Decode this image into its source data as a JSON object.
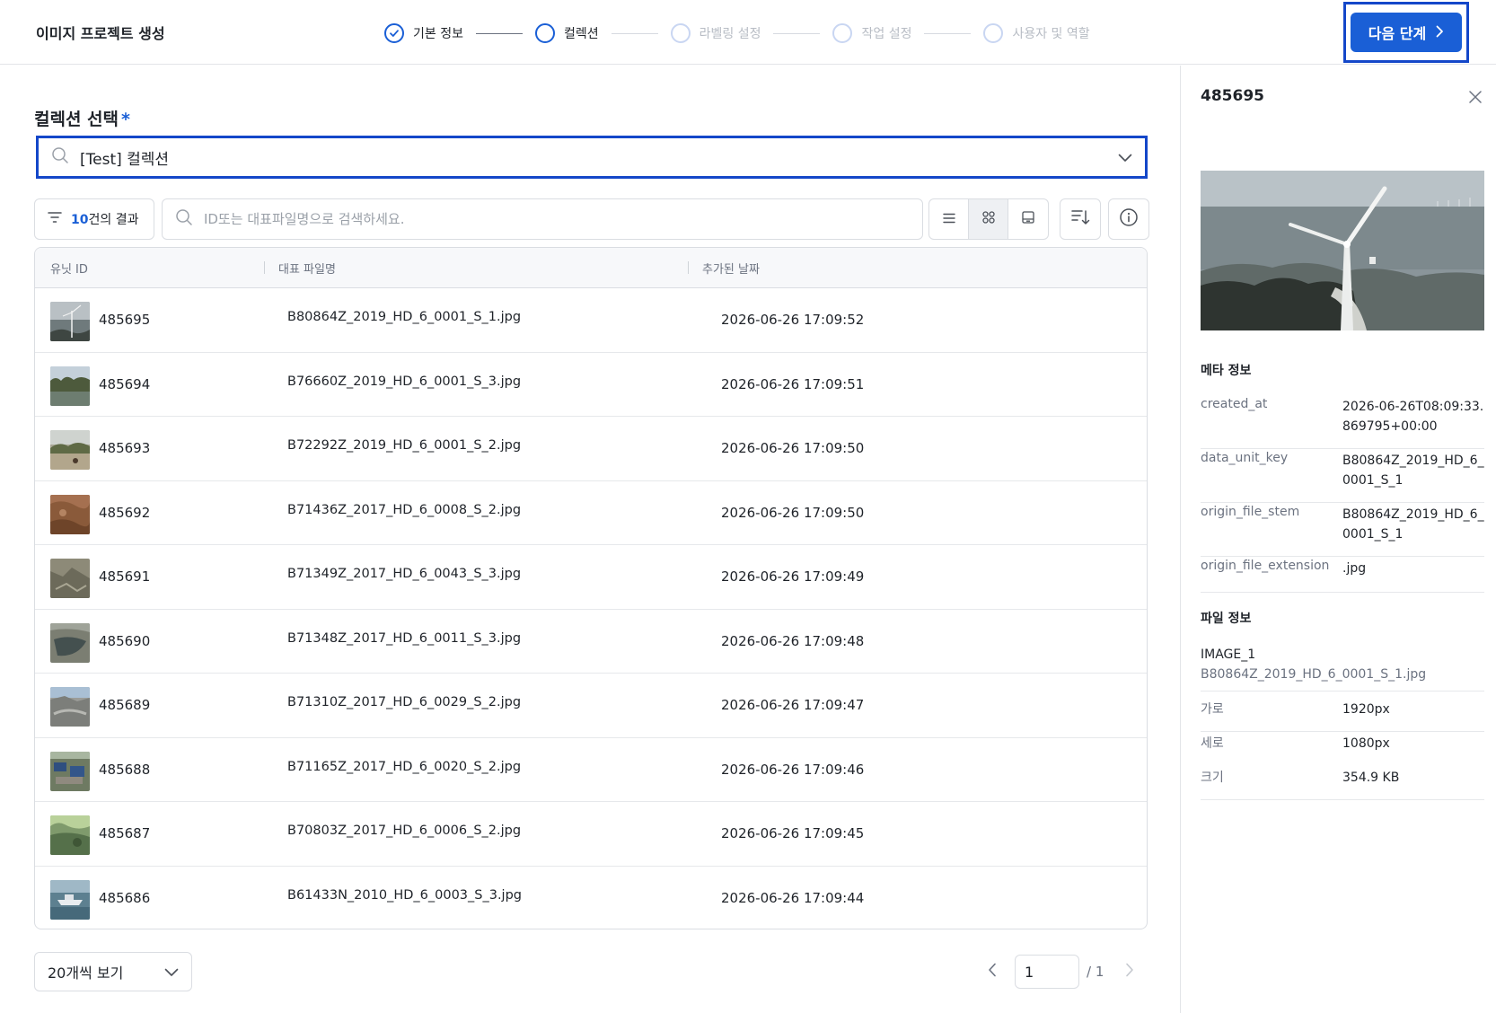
{
  "header": {
    "title": "이미지 프로젝트 생성",
    "steps": [
      {
        "label": "기본 정보",
        "state": "done"
      },
      {
        "label": "컬렉션",
        "state": "current"
      },
      {
        "label": "라벨링 설정",
        "state": "pending"
      },
      {
        "label": "작업 설정",
        "state": "pending"
      },
      {
        "label": "사용자 및 역할",
        "state": "pending"
      }
    ],
    "next_button": "다음 단계"
  },
  "collection": {
    "label": "컬렉션 선택",
    "required_mark": "*",
    "selected": "[Test] 컬렉션"
  },
  "toolbar": {
    "result_count": "10",
    "result_suffix": "건의 결과",
    "search_placeholder": "ID또는 대표파일명으로 검색하세요.",
    "view_modes": [
      "list",
      "grid",
      "gallery"
    ],
    "selected_view": "grid"
  },
  "table": {
    "columns": [
      "유닛 ID",
      "대표 파일명",
      "추가된 날짜"
    ],
    "rows": [
      {
        "id": "485695",
        "file": "B80864Z_2019_HD_6_0001_S_1.jpg",
        "date": "2026-06-26 17:09:52"
      },
      {
        "id": "485694",
        "file": "B76660Z_2019_HD_6_0001_S_3.jpg",
        "date": "2026-06-26 17:09:51"
      },
      {
        "id": "485693",
        "file": "B72292Z_2019_HD_6_0001_S_2.jpg",
        "date": "2026-06-26 17:09:50"
      },
      {
        "id": "485692",
        "file": "B71436Z_2017_HD_6_0008_S_2.jpg",
        "date": "2026-06-26 17:09:50"
      },
      {
        "id": "485691",
        "file": "B71349Z_2017_HD_6_0043_S_3.jpg",
        "date": "2026-06-26 17:09:49"
      },
      {
        "id": "485690",
        "file": "B71348Z_2017_HD_6_0011_S_3.jpg",
        "date": "2026-06-26 17:09:48"
      },
      {
        "id": "485689",
        "file": "B71310Z_2017_HD_6_0029_S_2.jpg",
        "date": "2026-06-26 17:09:47"
      },
      {
        "id": "485688",
        "file": "B71165Z_2017_HD_6_0020_S_2.jpg",
        "date": "2026-06-26 17:09:46"
      },
      {
        "id": "485687",
        "file": "B70803Z_2017_HD_6_0006_S_2.jpg",
        "date": "2026-06-26 17:09:45"
      },
      {
        "id": "485686",
        "file": "B61433N_2010_HD_6_0003_S_3.jpg",
        "date": "2026-06-26 17:09:44"
      }
    ]
  },
  "pagination": {
    "page_size": "20개씩 보기",
    "current_page": "1",
    "total": "/ 1"
  },
  "detail": {
    "title": "485695",
    "meta_title": "메타 정보",
    "meta": [
      {
        "key": "created_at",
        "value": "2026-06-26T08:09:33.869795+00:00"
      },
      {
        "key": "data_unit_key",
        "value": "B80864Z_2019_HD_6_0001_S_1"
      },
      {
        "key": "origin_file_stem",
        "value": "B80864Z_2019_HD_6_0001_S_1"
      },
      {
        "key": "origin_file_extension",
        "value": ".jpg"
      }
    ],
    "file_title": "파일 정보",
    "file_type": "IMAGE_1",
    "file_name": "B80864Z_2019_HD_6_0001_S_1.jpg",
    "file_props": [
      {
        "key": "가로",
        "value": "1920px"
      },
      {
        "key": "세로",
        "value": "1080px"
      },
      {
        "key": "크기",
        "value": "354.9 KB"
      }
    ]
  },
  "colors": {
    "accent": "#1a5fd6",
    "focus_border": "#1447c9",
    "muted_text": "#6b7280"
  }
}
